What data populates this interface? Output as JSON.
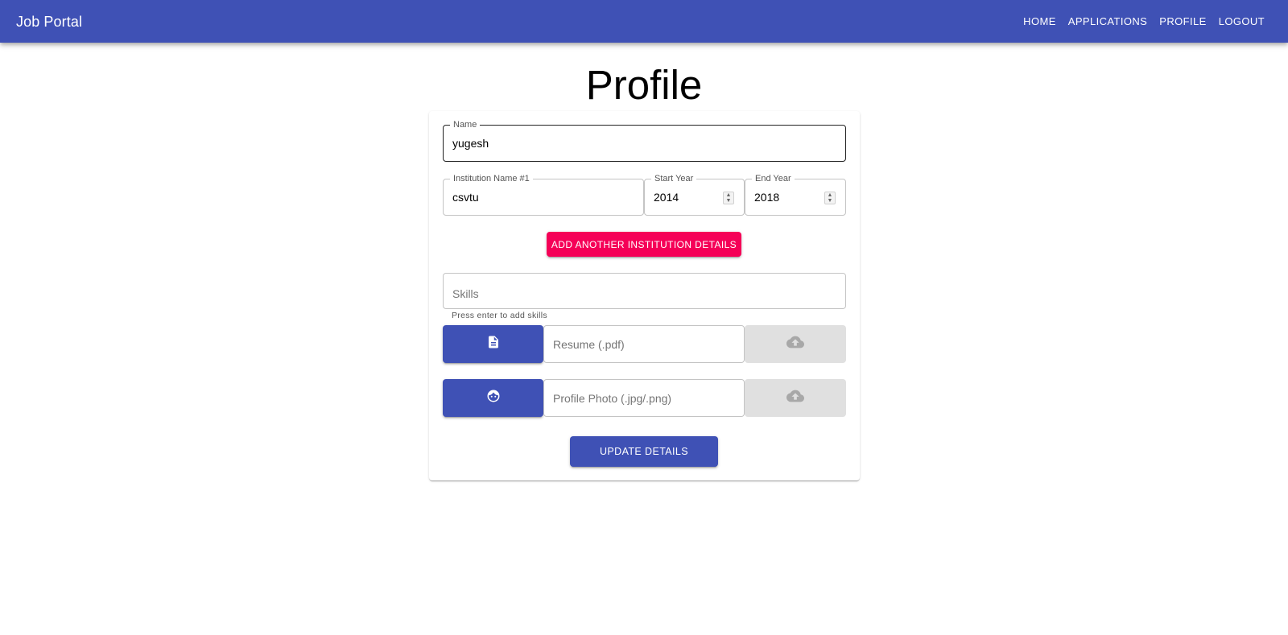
{
  "appbar": {
    "title": "Job Portal",
    "nav": [
      "Home",
      "Applications",
      "Profile",
      "Logout"
    ]
  },
  "page": {
    "title": "Profile"
  },
  "form": {
    "name": {
      "label": "Name",
      "value": "yugesh"
    },
    "institution": {
      "label": "Institution Name #1",
      "value": "csvtu"
    },
    "start_year": {
      "label": "Start Year",
      "value": "2014"
    },
    "end_year": {
      "label": "End Year",
      "value": "2018"
    },
    "add_institution_label": "Add another institution details",
    "skills": {
      "placeholder": "Skills",
      "helper": "Press enter to add skills"
    },
    "resume": {
      "placeholder": "Resume (.pdf)",
      "icon": "description-icon"
    },
    "photo": {
      "placeholder": "Profile Photo (.jpg/.png)",
      "icon": "face-icon"
    },
    "upload_icon": "cloud-upload-icon",
    "update_label": "Update Details"
  },
  "colors": {
    "primary": "#3f51b5",
    "secondary": "#f50057",
    "disabled": "#e0e0e0"
  }
}
